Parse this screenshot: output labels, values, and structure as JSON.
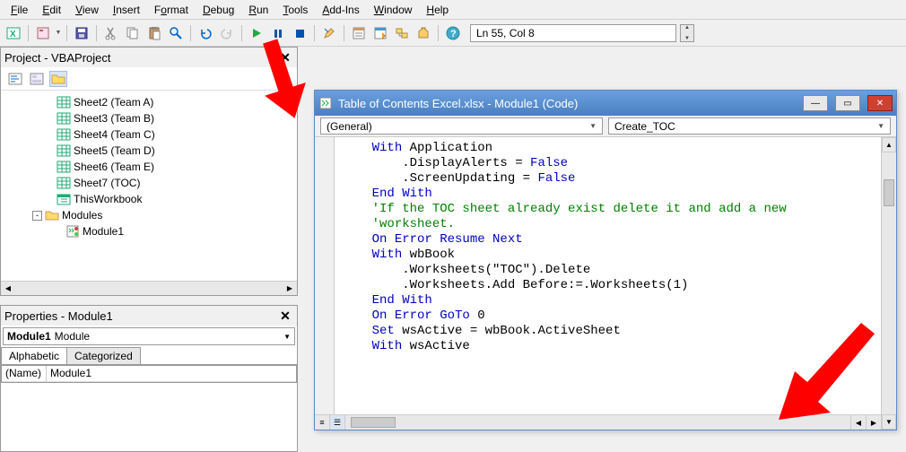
{
  "menubar": [
    {
      "key": "F",
      "label": "File"
    },
    {
      "key": "E",
      "label": "Edit"
    },
    {
      "key": "V",
      "label": "View"
    },
    {
      "key": "I",
      "label": "Insert"
    },
    {
      "key": "o",
      "label": "Format"
    },
    {
      "key": "D",
      "label": "Debug"
    },
    {
      "key": "R",
      "label": "Run"
    },
    {
      "key": "T",
      "label": "Tools"
    },
    {
      "key": "A",
      "label": "Add-Ins"
    },
    {
      "key": "W",
      "label": "Window"
    },
    {
      "key": "H",
      "label": "Help"
    }
  ],
  "toolbar": {
    "position_text": "Ln 55, Col 8"
  },
  "project_panel": {
    "title": "Project - VBAProject",
    "tree": [
      {
        "indent": 50,
        "icon": "sheet",
        "label": "Sheet2 (Team A)"
      },
      {
        "indent": 50,
        "icon": "sheet",
        "label": "Sheet3 (Team B)"
      },
      {
        "indent": 50,
        "icon": "sheet",
        "label": "Sheet4 (Team C)"
      },
      {
        "indent": 50,
        "icon": "sheet",
        "label": "Sheet5 (Team D)"
      },
      {
        "indent": 50,
        "icon": "sheet",
        "label": "Sheet6 (Team E)"
      },
      {
        "indent": 50,
        "icon": "sheet",
        "label": "Sheet7 (TOC)"
      },
      {
        "indent": 50,
        "icon": "workbook",
        "label": "ThisWorkbook"
      },
      {
        "indent": 30,
        "icon": "folder",
        "label": "Modules",
        "expander": "-"
      },
      {
        "indent": 60,
        "icon": "module",
        "label": "Module1"
      }
    ]
  },
  "properties_panel": {
    "title": "Properties - Module1",
    "object_name": "Module1",
    "object_type": "Module",
    "tabs": [
      "Alphabetic",
      "Categorized"
    ],
    "rows": [
      {
        "k": "(Name)",
        "v": "Module1"
      }
    ]
  },
  "code_window": {
    "title": "Table of Contents Excel.xlsx - Module1 (Code)",
    "combo_left": "(General)",
    "combo_right": "Create_TOC",
    "lines": [
      {
        "indent": 4,
        "tokens": [
          {
            "t": "With ",
            "c": "kw"
          },
          {
            "t": "Application"
          }
        ]
      },
      {
        "indent": 8,
        "tokens": [
          {
            "t": ".DisplayAlerts = "
          },
          {
            "t": "False",
            "c": "kw"
          }
        ]
      },
      {
        "indent": 8,
        "tokens": [
          {
            "t": ".ScreenUpdating = "
          },
          {
            "t": "False",
            "c": "kw"
          }
        ]
      },
      {
        "indent": 4,
        "tokens": [
          {
            "t": "End With",
            "c": "kw"
          }
        ]
      },
      {
        "indent": 4,
        "tokens": [
          {
            "t": "'If the TOC sheet already exist delete it and add a new",
            "c": "cm"
          }
        ]
      },
      {
        "indent": 4,
        "tokens": [
          {
            "t": "'worksheet.",
            "c": "cm"
          }
        ]
      },
      {
        "indent": 4,
        "tokens": [
          {
            "t": "On Error Resume Next",
            "c": "kw"
          }
        ]
      },
      {
        "indent": 4,
        "tokens": [
          {
            "t": "With ",
            "c": "kw"
          },
          {
            "t": "wbBook"
          }
        ]
      },
      {
        "indent": 8,
        "tokens": [
          {
            "t": ".Worksheets("
          },
          {
            "t": "\"TOC\""
          },
          {
            "t": ").Delete"
          }
        ]
      },
      {
        "indent": 8,
        "tokens": [
          {
            "t": ".Worksheets.Add Before:=.Worksheets(1)"
          }
        ]
      },
      {
        "indent": 4,
        "tokens": [
          {
            "t": "End With",
            "c": "kw"
          }
        ]
      },
      {
        "indent": 4,
        "tokens": [
          {
            "t": "On Error GoTo ",
            "c": "kw"
          },
          {
            "t": "0"
          }
        ]
      },
      {
        "indent": 4,
        "tokens": [
          {
            "t": "Set ",
            "c": "kw"
          },
          {
            "t": "wsActive = wbBook.ActiveSheet"
          }
        ]
      },
      {
        "indent": 4,
        "tokens": [
          {
            "t": "With ",
            "c": "kw"
          },
          {
            "t": "wsActive"
          }
        ]
      }
    ]
  }
}
